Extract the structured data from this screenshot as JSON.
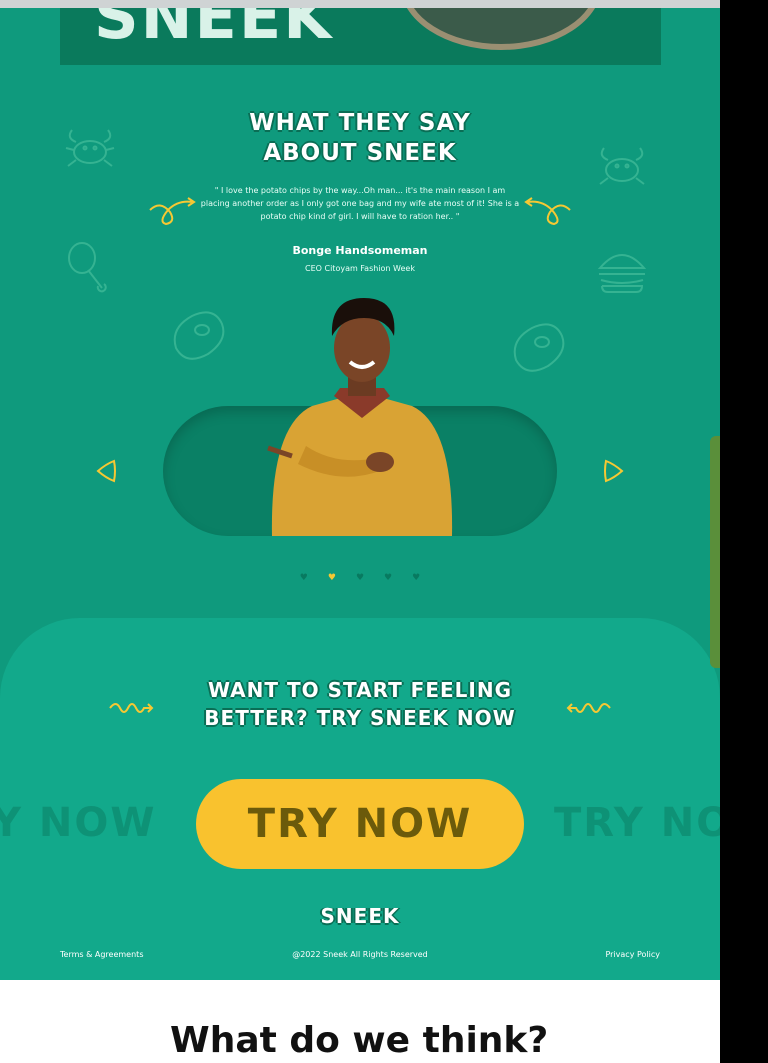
{
  "hero": {
    "logo_text": "SNEEK"
  },
  "testimonial": {
    "title_line1": "WHAT THEY SAY",
    "title_line2": "ABOUT SNEEK",
    "quote": "\" I love the potato chips by the way...Oh man... it's the main reason I am placing another order as I only got one bag and my wife ate most of it! She is a potato chip kind of girl. I will have to ration her.. \"",
    "author": "Bonge Handsomeman",
    "role": "CEO Citoyam Fashion Week",
    "dots": 5,
    "active_dot": 2
  },
  "cta": {
    "title_line1": "WANT TO START FEELING",
    "title_line2": "BETTER? TRY SNEEK NOW",
    "button_label": "TRY NOW",
    "ghost_left": "Y NOW",
    "ghost_right": "TRY NO"
  },
  "footer": {
    "logo": "SNEEK",
    "terms": "Terms & Agreements",
    "copyright": "@2022 Sneek All Rights Reserved",
    "privacy": "Privacy Policy"
  },
  "next_section": {
    "heading": "What do we think?"
  },
  "colors": {
    "green": "#0f9a7d",
    "cta_green": "#12a98b",
    "accent_yellow": "#f9c22e",
    "dark_green": "#0a7a5c"
  },
  "icons": [
    "crab-icon",
    "drumstick-icon",
    "steak-icon",
    "burger-icon",
    "arrow-left-icon",
    "arrow-right-icon",
    "swirl-arrow-icon"
  ]
}
